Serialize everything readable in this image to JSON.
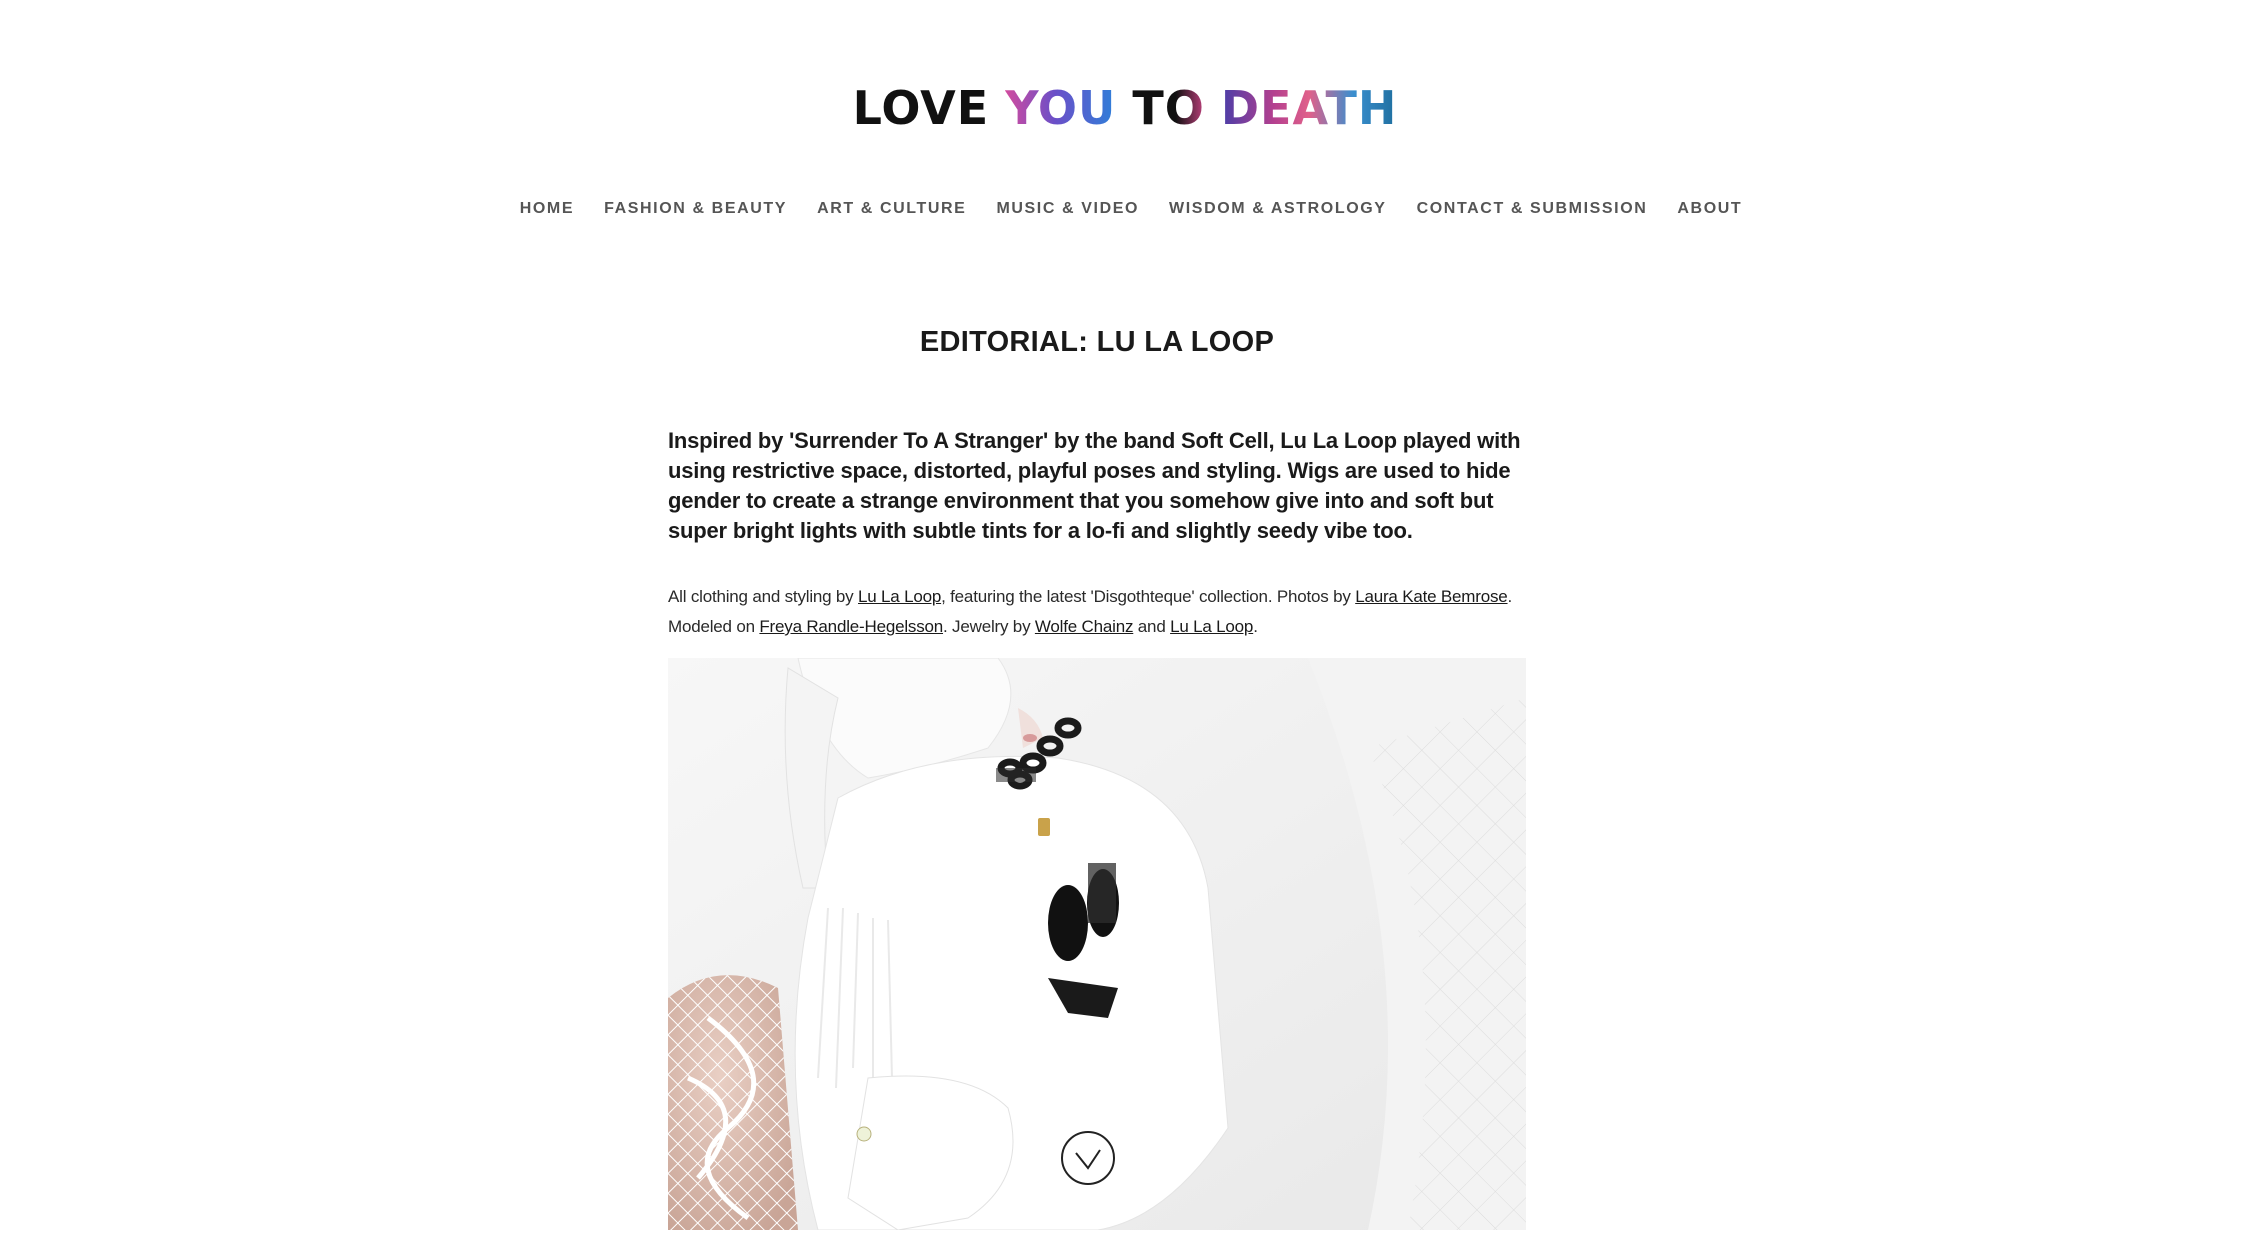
{
  "logo": {
    "word1": "LOVE",
    "word2": "YOU",
    "word3": "TO",
    "word4": "DEATH"
  },
  "nav": {
    "items": [
      {
        "label": "HOME"
      },
      {
        "label": "FASHION & BEAUTY"
      },
      {
        "label": "ART & CULTURE"
      },
      {
        "label": "MUSIC & VIDEO"
      },
      {
        "label": "WISDOM & ASTROLOGY"
      },
      {
        "label": "CONTACT & SUBMISSION"
      },
      {
        "label": "ABOUT"
      }
    ]
  },
  "article": {
    "title": "EDITORIAL: LU LA LOOP",
    "lead": "Inspired by 'Surrender To A Stranger' by the band Soft Cell, Lu La Loop played with using restrictive space, distorted, playful poses and styling. Wigs are used to hide gender to create a strange environment that you somehow give into and soft but super bright lights with subtle tints for a lo-fi and slightly seedy vibe too.",
    "credits": {
      "t1": "All clothing and styling by ",
      "link_lulaloop_1": "Lu La Loop",
      "t2": ", featuring the latest 'Disgothteque' collection. Photos by ",
      "link_photographer": "Laura Kate Bemrose",
      "t3": ". Modeled on ",
      "link_model": "Freya Randle-Hegelsson",
      "t4": ". Jewelry by ",
      "link_jewelry": "Wolfe Chainz",
      "t5": " and ",
      "link_lulaloop_2": "Lu La Loop",
      "t6": "."
    }
  },
  "colors": {
    "text": "#1a1a1a",
    "nav_text": "#555555",
    "background": "#ffffff"
  }
}
